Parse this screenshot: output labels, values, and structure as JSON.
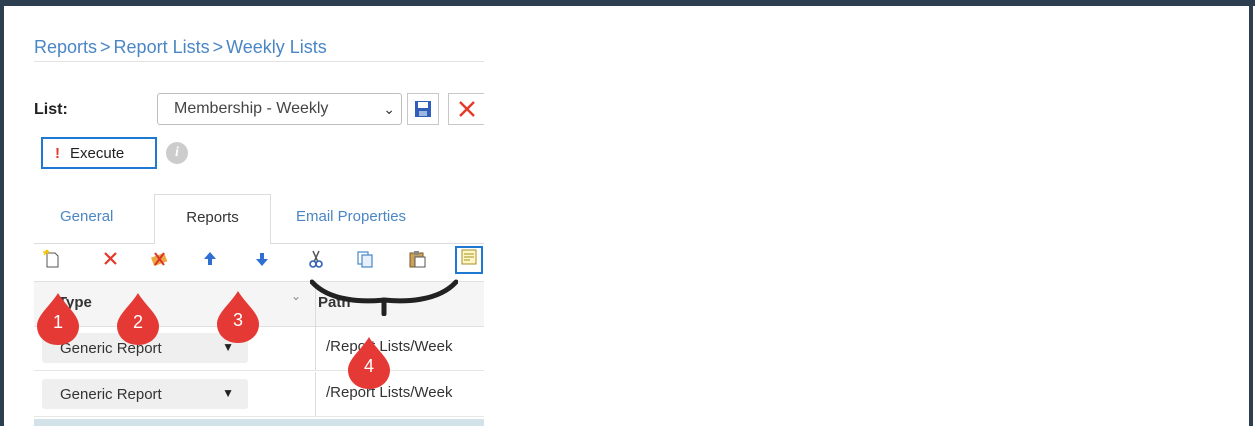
{
  "breadcrumb": [
    "Reports",
    "Report Lists",
    "Weekly Lists"
  ],
  "breadcrumb_separator": ">",
  "list_label": "List:",
  "list_select": {
    "value": "Membership - Weekly"
  },
  "execute_label": "Execute",
  "info_glyph": "i",
  "tabs": [
    {
      "label": "General"
    },
    {
      "label": "Reports",
      "active": true
    },
    {
      "label": "Email Properties"
    }
  ],
  "toolbar_icons": [
    "new-report-icon",
    "delete-icon",
    "clear-icon",
    "move-up-icon",
    "move-down-icon",
    "cut-icon",
    "copy-icon",
    "paste-icon",
    "view-icon"
  ],
  "grid": {
    "columns": [
      "Type",
      "Path"
    ],
    "rows": [
      {
        "type": "Generic Report",
        "path": "/Report Lists/Week"
      },
      {
        "type": "Generic Report",
        "path": "/Report Lists/Week"
      }
    ]
  },
  "callouts": [
    "1",
    "2",
    "3",
    "4"
  ],
  "colors": {
    "accent_blue": "#4a86c5",
    "callout_red": "#e53935",
    "frame": "#2d3e50"
  }
}
